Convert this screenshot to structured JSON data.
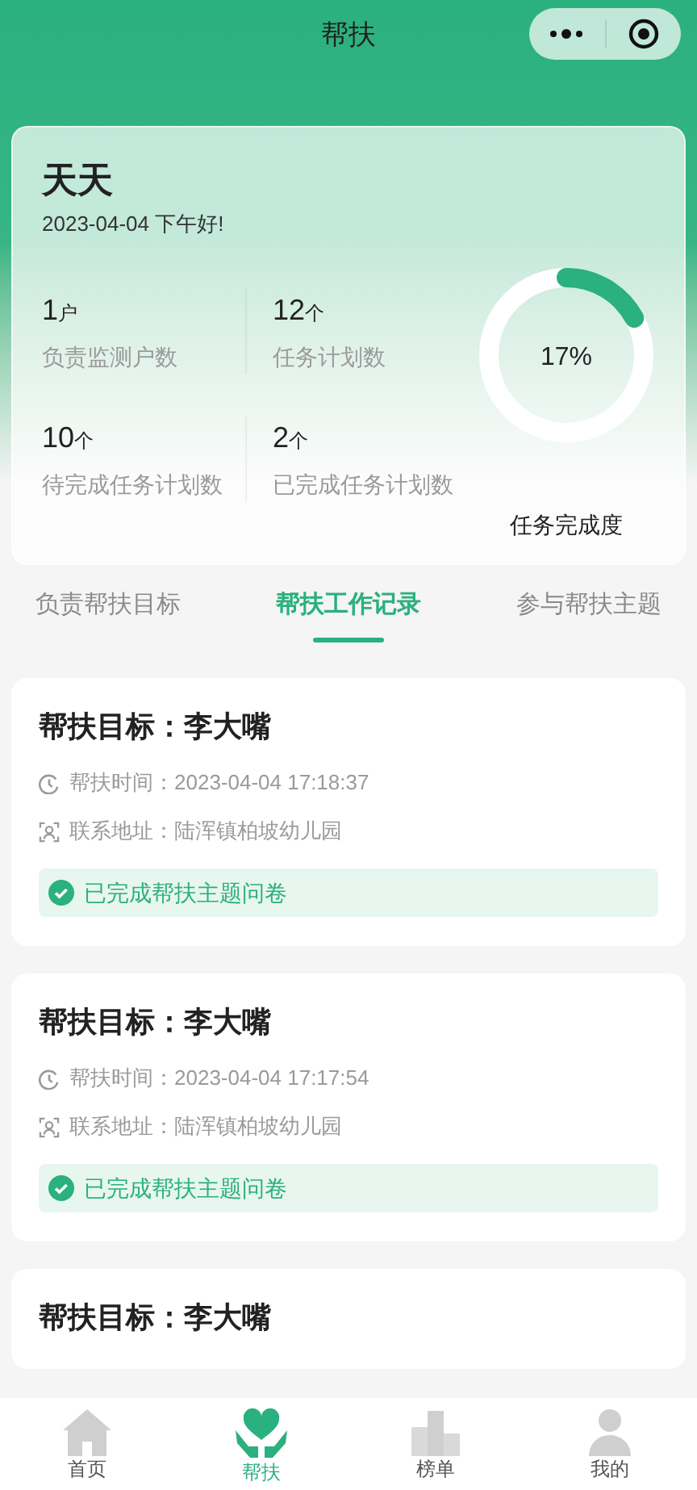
{
  "nav": {
    "title": "帮扶"
  },
  "summary": {
    "name": "天天",
    "greeting": "2023-04-04 下午好!",
    "stats": [
      {
        "value": "1",
        "unit": "户",
        "label": "负责监测户数"
      },
      {
        "value": "12",
        "unit": "个",
        "label": "任务计划数"
      },
      {
        "value": "10",
        "unit": "个",
        "label": "待完成任务计划数"
      },
      {
        "value": "2",
        "unit": "个",
        "label": "已完成任务计划数"
      }
    ],
    "progress": {
      "level": 0.17,
      "reading": "17%",
      "label": "任务完成度"
    }
  },
  "tabs": [
    {
      "label": "负责帮扶目标",
      "selected": false
    },
    {
      "label": "帮扶工作记录",
      "selected": true
    },
    {
      "label": "参与帮扶主题",
      "selected": false
    }
  ],
  "records": [
    {
      "title": "帮扶目标：李大嘴",
      "time_label": "帮扶时间：",
      "time": "2023-04-04 17:18:37",
      "address_label": "联系地址：",
      "address": "陆浑镇柏坡幼儿园",
      "status": "已完成帮扶主题问卷"
    },
    {
      "title": "帮扶目标：李大嘴",
      "time_label": "帮扶时间：",
      "time": "2023-04-04 17:17:54",
      "address_label": "联系地址：",
      "address": "陆浑镇柏坡幼儿园",
      "status": "已完成帮扶主题问卷"
    },
    {
      "title": "帮扶目标：李大嘴"
    }
  ],
  "tab_bar": [
    {
      "label": "首页",
      "kind": "home",
      "selected": false
    },
    {
      "label": "帮扶",
      "kind": "help",
      "selected": true
    },
    {
      "label": "榜单",
      "kind": "rank",
      "selected": false
    },
    {
      "label": "我的",
      "kind": "me",
      "selected": false
    }
  ]
}
